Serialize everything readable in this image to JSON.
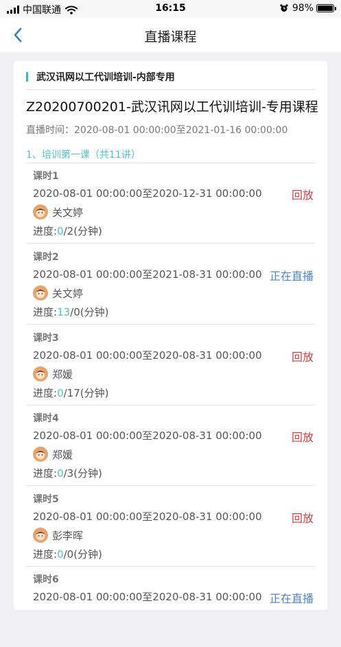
{
  "status_bar": {
    "carrier": "中国联通",
    "time": "16:15",
    "battery": "98%",
    "battery_level": 0.98
  },
  "nav": {
    "title": "直播课程",
    "back_icon": "chevron-left-icon"
  },
  "section": {
    "name": "武汉讯网以工代训培训-内部专用"
  },
  "course": {
    "title": "Z20200700201-武汉讯网以工代训培训-专用课程",
    "live_time": "直播时间：2020-08-01 00:00:00至2021-01-16 00:00:00"
  },
  "chapter": {
    "title": "1、培训第一课（共11讲）"
  },
  "lessons": [
    {
      "name": "课时1",
      "range": "2020-08-01 00:00:00至2020-12-31 00:00:00",
      "action": "回放",
      "teacher": "关文婷",
      "progress_label": "进度:",
      "progress_done": "0",
      "progress_total": "/2(分钟)"
    },
    {
      "name": "课时2",
      "range": "2020-08-01 00:00:00至2021-08-31 00:00:00",
      "action": "正在直播",
      "teacher": "关文婷",
      "progress_label": "进度:",
      "progress_done": "13",
      "progress_total": "/0(分钟)"
    },
    {
      "name": "课时3",
      "range": "2020-08-01 00:00:00至2020-08-31 00:00:00",
      "action": "回放",
      "teacher": "郑媛",
      "progress_label": "进度:",
      "progress_done": "0",
      "progress_total": "/17(分钟)"
    },
    {
      "name": "课时4",
      "range": "2020-08-01 00:00:00至2020-08-31 00:00:00",
      "action": "回放",
      "teacher": "郑媛",
      "progress_label": "进度:",
      "progress_done": "0",
      "progress_total": "/3(分钟)"
    },
    {
      "name": "课时5",
      "range": "2020-08-01 00:00:00至2020-08-31 00:00:00",
      "action": "回放",
      "teacher": "彭李晖",
      "progress_label": "进度:",
      "progress_done": "0",
      "progress_total": "/0(分钟)"
    },
    {
      "name": "课时6",
      "range": "2020-08-01 00:00:00至2020-08-31 00:00:00",
      "action": "正在直播"
    }
  ],
  "colors": {
    "accent_teal": "#4fc3c8",
    "replay_red": "#d93d3d",
    "live_blue": "#4a86c8",
    "back_blue": "#3a7bd5"
  }
}
